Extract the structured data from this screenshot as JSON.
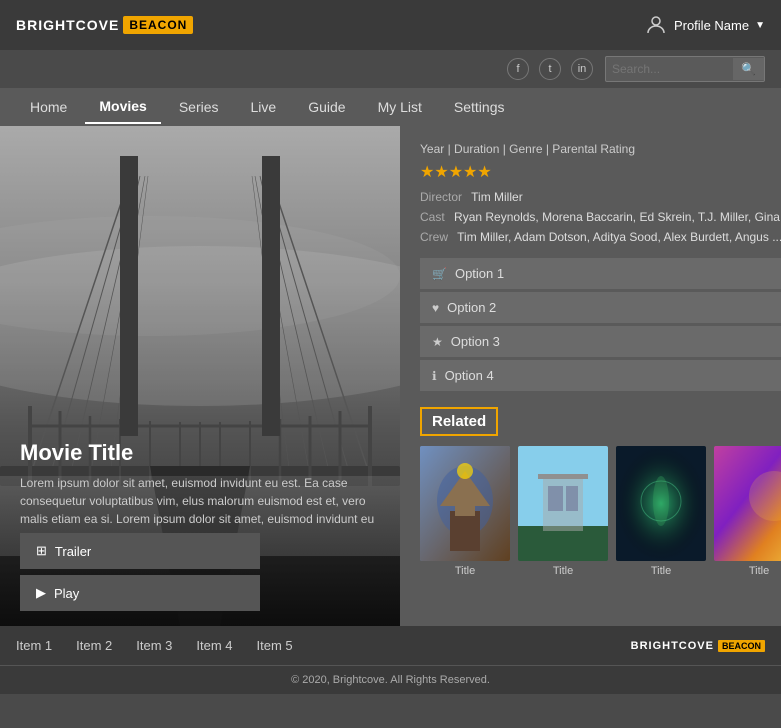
{
  "header": {
    "logo_brightcove": "BRIGHTCOVE",
    "logo_beacon": "BEACON",
    "profile_name": "Profile Name"
  },
  "nav": {
    "items": [
      {
        "label": "Home",
        "active": false
      },
      {
        "label": "Movies",
        "active": true
      },
      {
        "label": "Series",
        "active": false
      },
      {
        "label": "Live",
        "active": false
      },
      {
        "label": "Guide",
        "active": false
      },
      {
        "label": "My List",
        "active": false
      },
      {
        "label": "Settings",
        "active": false
      }
    ]
  },
  "movie": {
    "title": "Movie Title",
    "description": "Lorem ipsum dolor sit amet, euismod invidunt eu est. Ea case consequetur voluptatibus vim, elus malorum euismod est et, vero malis etiam ea si. Lorem ipsum dolor sit amet, euismod invidunt eu est.",
    "meta": "Year | Duration | Genre | Parental Rating",
    "director_label": "Director",
    "director_value": "Tim Miller",
    "cast_label": "Cast",
    "cast_value": "Ryan Reynolds, Morena Baccarin, Ed Skrein, T.J. Miller, Gina ...",
    "crew_label": "Crew",
    "crew_value": "Tim Miller, Adam Dotson, Aditya Sood, Alex Burdett, Angus ...",
    "stars": "★★★★★",
    "trailer_label": "Trailer",
    "play_label": "Play"
  },
  "options": [
    {
      "label": "Option 1",
      "icon": "🛒"
    },
    {
      "label": "Option 2",
      "icon": "♥"
    },
    {
      "label": "Option 3",
      "icon": "★"
    },
    {
      "label": "Option 4",
      "icon": "ℹ"
    }
  ],
  "related": {
    "title": "Related",
    "items": [
      {
        "title": "Title"
      },
      {
        "title": "Title"
      },
      {
        "title": "Title"
      },
      {
        "title": "Title"
      }
    ]
  },
  "footer": {
    "items": [
      {
        "label": "Item 1"
      },
      {
        "label": "Item 2"
      },
      {
        "label": "Item 3"
      },
      {
        "label": "Item 4"
      },
      {
        "label": "Item 5"
      }
    ],
    "logo_brightcove": "BRIGHTCOVE",
    "logo_beacon": "BEACON",
    "copyright": "© 2020, Brightcove. All Rights Reserved."
  },
  "search": {
    "placeholder": "Search..."
  }
}
